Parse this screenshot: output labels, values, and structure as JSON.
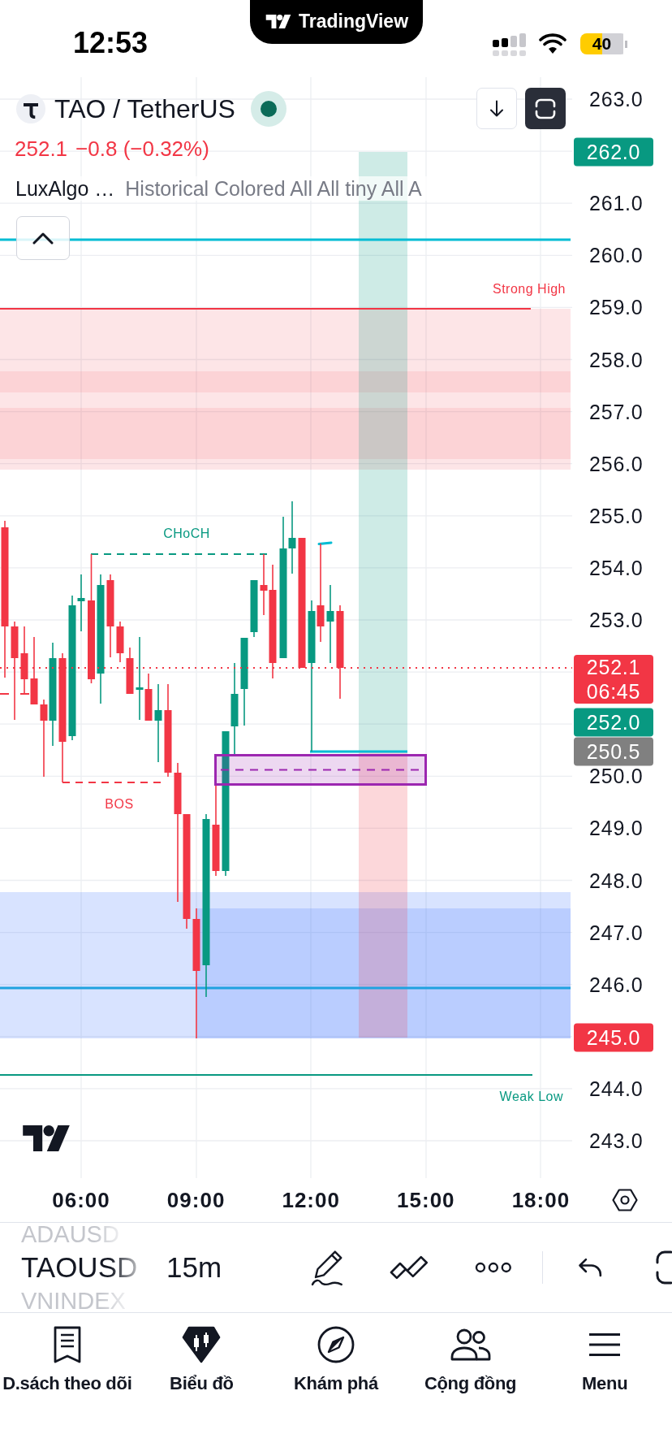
{
  "status_bar": {
    "time": "12:53",
    "island_label": "TradingView",
    "battery": "40"
  },
  "header": {
    "symbol": "TAO / TetherUS",
    "quote": {
      "price": "252.1",
      "change": "−0.8 (−0.32%)",
      "falling": true
    },
    "indicator": {
      "name": "LuxAlgo …",
      "settings": "Historical Colored All All tiny All A"
    }
  },
  "chart": {
    "labels": [
      {
        "text": "Strong High",
        "color": "#f23645"
      },
      {
        "text": "CHoCH",
        "color": "#089981"
      },
      {
        "text": "BOS",
        "color": "#f23645"
      },
      {
        "text": "Weak Low",
        "color": "#089981"
      }
    ],
    "price_axis": {
      "ticks": [
        "263.0",
        "261.0",
        "260.0",
        "259.0",
        "258.0",
        "257.0",
        "256.0",
        "255.0",
        "254.0",
        "253.0",
        "250.0",
        "249.0",
        "248.0",
        "247.0",
        "246.0",
        "244.0",
        "243.0"
      ],
      "tags": [
        {
          "price": "262.0",
          "color": "#089981"
        },
        {
          "price": "252.1",
          "countdown": "06:45",
          "color": "#f23645"
        },
        {
          "price": "252.0",
          "color": "#089981"
        },
        {
          "price": "250.5",
          "color": "#808080"
        },
        {
          "price": "245.0",
          "color": "#f23645"
        }
      ]
    },
    "time_axis": {
      "ticks": [
        "06:00",
        "09:00",
        "12:00",
        "15:00",
        "18:00"
      ]
    }
  },
  "toolbar": {
    "symbols": [
      {
        "text": "ADAUSD",
        "selected": false
      },
      {
        "text": "TAOUSD",
        "selected": true
      },
      {
        "text": "VNINDEX",
        "selected": false
      }
    ],
    "interval": "15m"
  },
  "tabs": [
    {
      "label": "D.sách theo dõi",
      "selected": false
    },
    {
      "label": "Biểu đồ",
      "selected": true
    },
    {
      "label": "Khám phá",
      "selected": false
    },
    {
      "label": "Cộng đồng",
      "selected": false
    },
    {
      "label": "Menu",
      "selected": false
    }
  ]
}
